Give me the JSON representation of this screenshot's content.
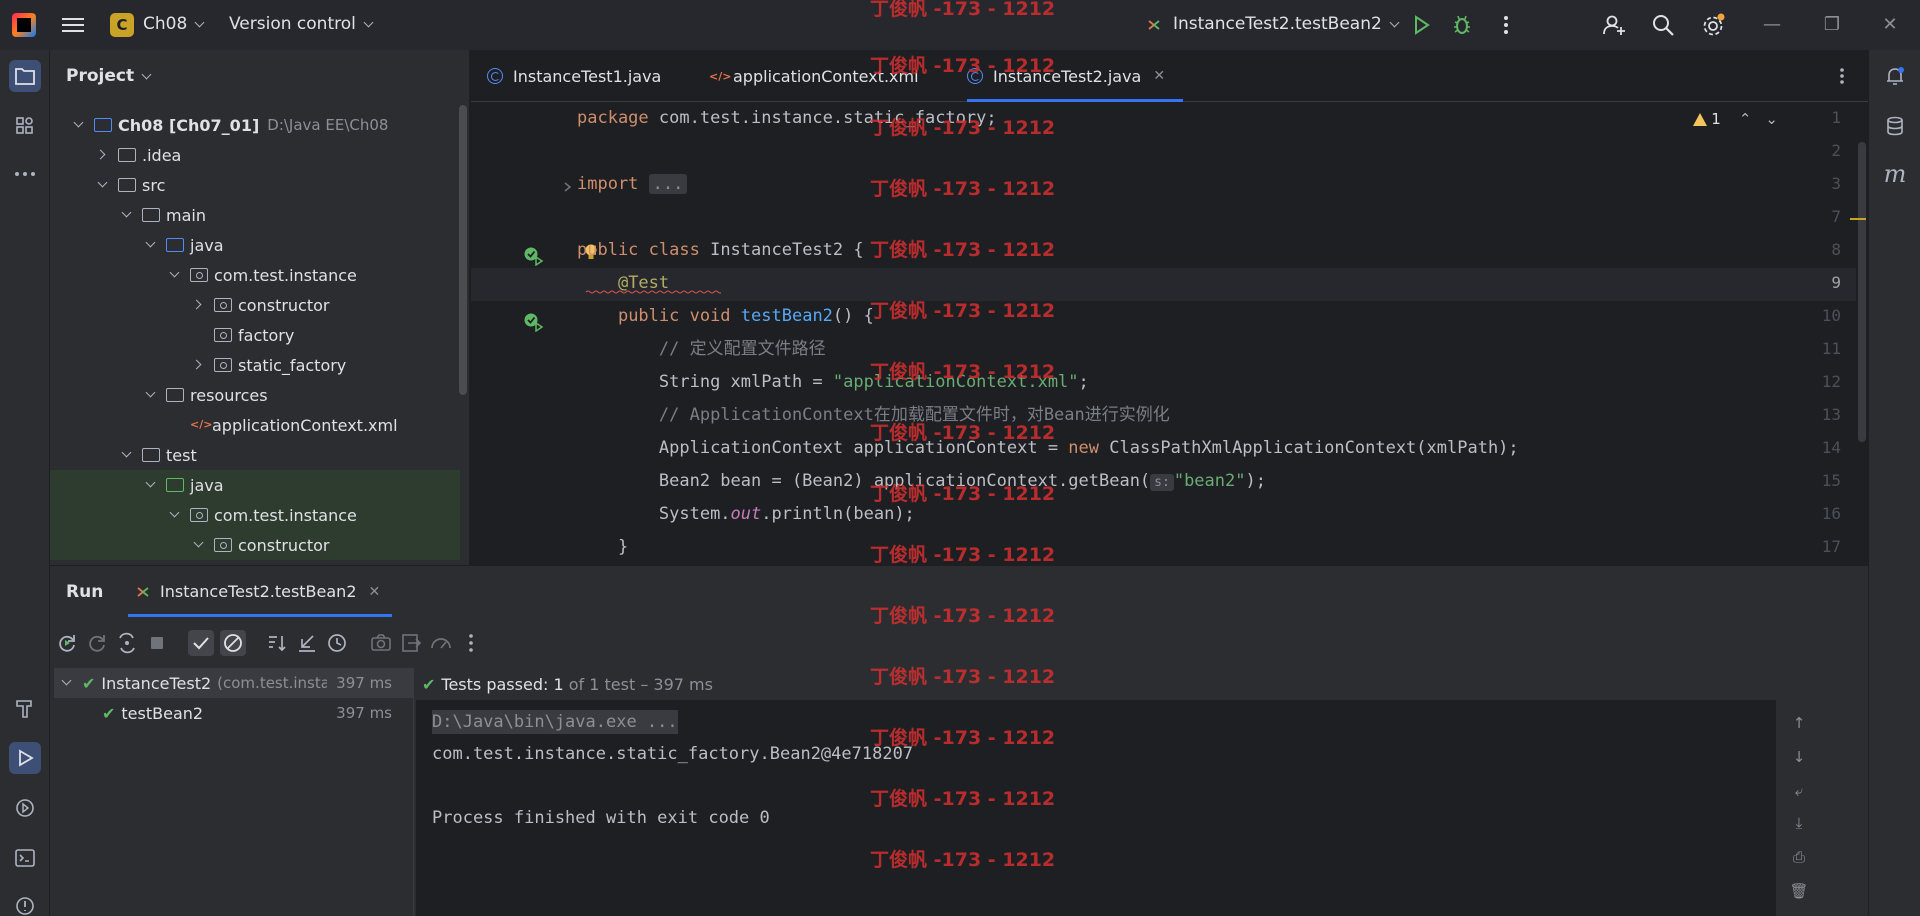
{
  "titlebar": {
    "project_badge": "C",
    "project_name": "Ch08",
    "version_control": "Version control",
    "run_config": "InstanceTest2.testBean2"
  },
  "project_panel": {
    "title": "Project",
    "tree": [
      {
        "label": "Ch08 [Ch07_01]",
        "secondary": "D:\\Java EE\\Ch08",
        "depth": 0,
        "arrow": "open",
        "icon": "module"
      },
      {
        "label": ".idea",
        "depth": 1,
        "arrow": "closed",
        "icon": "folder"
      },
      {
        "label": "src",
        "depth": 1,
        "arrow": "open",
        "icon": "folder"
      },
      {
        "label": "main",
        "depth": 2,
        "arrow": "open",
        "icon": "folder"
      },
      {
        "label": "java",
        "depth": 3,
        "arrow": "open",
        "icon": "folder-blue"
      },
      {
        "label": "com.test.instance",
        "depth": 4,
        "arrow": "open",
        "icon": "package"
      },
      {
        "label": "constructor",
        "depth": 5,
        "arrow": "closed",
        "icon": "package"
      },
      {
        "label": "factory",
        "depth": 5,
        "arrow": "none",
        "icon": "package"
      },
      {
        "label": "static_factory",
        "depth": 5,
        "arrow": "closed",
        "icon": "package"
      },
      {
        "label": "resources",
        "depth": 3,
        "arrow": "open",
        "icon": "folder-res"
      },
      {
        "label": "applicationContext.xml",
        "depth": 4,
        "arrow": "none",
        "icon": "xml"
      },
      {
        "label": "test",
        "depth": 2,
        "arrow": "open",
        "icon": "folder"
      },
      {
        "label": "java",
        "depth": 3,
        "arrow": "open",
        "icon": "folder-green"
      },
      {
        "label": "com.test.instance",
        "depth": 4,
        "arrow": "open",
        "icon": "package"
      },
      {
        "label": "constructor",
        "depth": 5,
        "arrow": "open",
        "icon": "package"
      }
    ]
  },
  "editor": {
    "tabs": [
      {
        "label": "InstanceTest1.java",
        "type": "java"
      },
      {
        "label": "applicationContext.xml",
        "type": "xml"
      },
      {
        "label": "InstanceTest2.java",
        "type": "java",
        "active": true
      }
    ],
    "warnings": "1",
    "line_numbers": [
      "1",
      "2",
      "3",
      "7",
      "8",
      "9",
      "10",
      "11",
      "12",
      "13",
      "14",
      "15",
      "16",
      "17"
    ],
    "current_line": "9",
    "code": {
      "l1_kw": "package",
      "l1_rest": " com.test.instance.static_factory;",
      "l3_kw": "import",
      "l3_fold": "...",
      "l8_kw": "public class",
      "l8_name": "InstanceTest2",
      "l8_rest": " {",
      "l9_ann": "@Test",
      "l10_kw": "public void",
      "l10_fn": "testBean2",
      "l10_rest": "() {",
      "l11_cmt": "// 定义配置文件路径",
      "l12_a": "String xmlPath = ",
      "l12_str": "\"applicationContext.xml\"",
      "l12_b": ";",
      "l13_cmt": "// ApplicationContext在加载配置文件时，对Bean进行实例化",
      "l14_a": "ApplicationContext applicationContext = ",
      "l14_kw": "new",
      "l14_b": " ClassPathXmlApplicationContext(xmlPath);",
      "l15_a": "Bean2 bean = (Bean2) applicationContext.getBean(",
      "l15_hint": "s:",
      "l15_str": "\"bean2\"",
      "l15_b": ");",
      "l16_a": "System.",
      "l16_fld": "out",
      "l16_b": ".println(bean);",
      "l17": "}"
    }
  },
  "run_panel": {
    "title": "Run",
    "tab_label": "InstanceTest2.testBean2",
    "tests": [
      {
        "label": "InstanceTest2",
        "secondary": "(com.test.insta",
        "time": "397 ms"
      },
      {
        "label": "testBean2",
        "time": "397 ms"
      }
    ],
    "status_prefix": "Tests passed:",
    "status_count": "1",
    "status_suffix": "of 1 test – 397 ms",
    "console": [
      "D:\\Java\\bin\\java.exe ...",
      "com.test.instance.static_factory.Bean2@4e718207",
      "",
      "Process finished with exit code 0"
    ]
  },
  "watermark": "丁俊帆 -173 - 1212"
}
